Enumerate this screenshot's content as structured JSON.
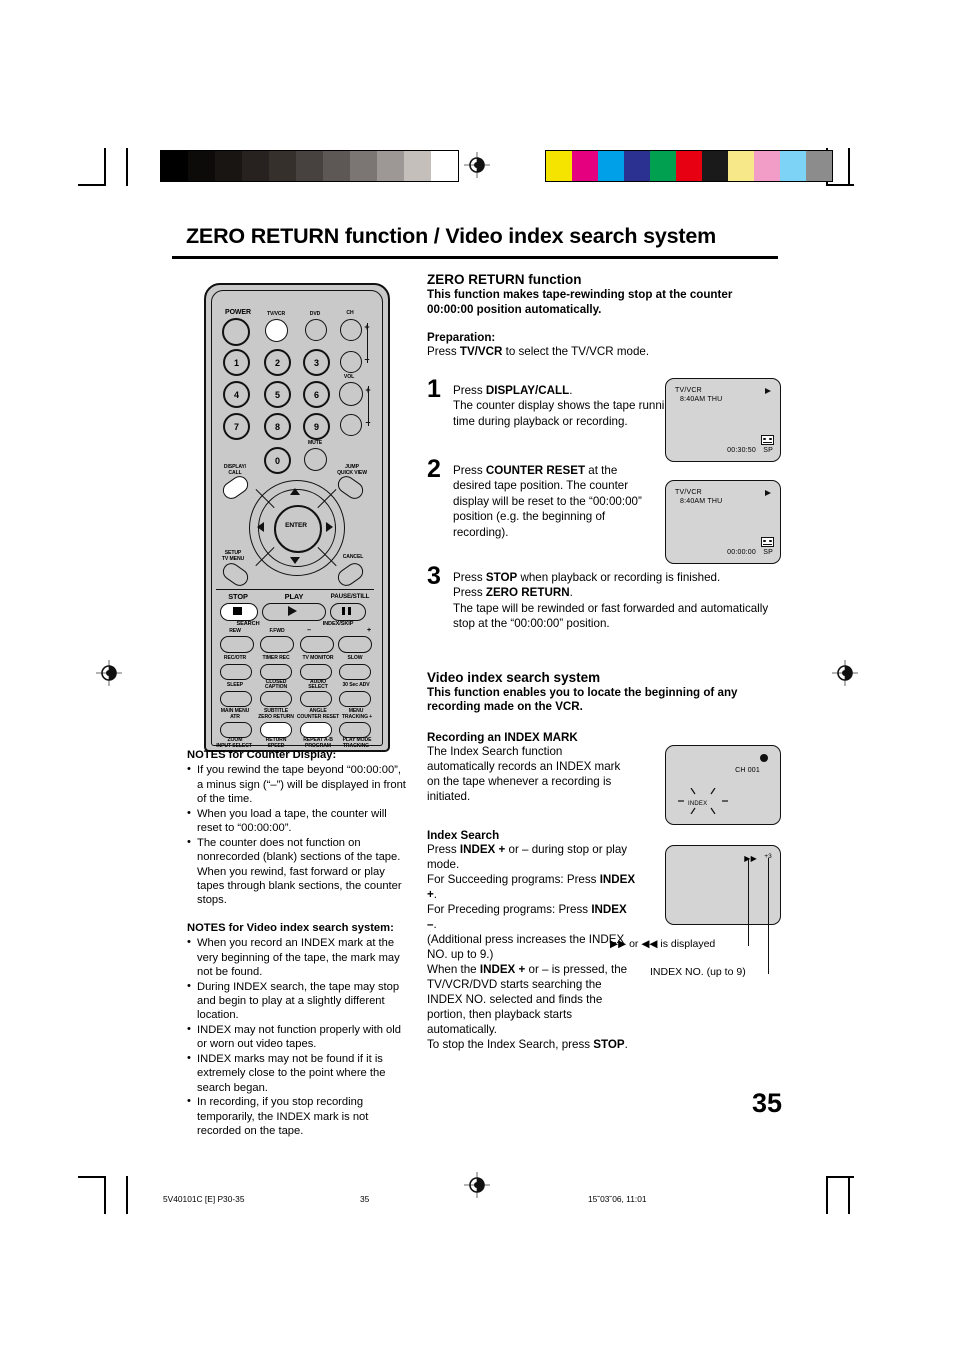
{
  "header": {
    "title": "ZERO RETURN function / Video index search system"
  },
  "zero_return": {
    "heading": "ZERO RETURN function",
    "lead_line1": "This function makes tape-rewinding stop at the counter",
    "lead_line2": "00:00:00 position automatically.",
    "prep_title": "Preparation:",
    "prep_pre": "Press ",
    "prep_bold": "TV/VCR",
    "prep_post": " to select the TV/VCR mode.",
    "steps": [
      {
        "num": "1",
        "l1_pre": "Press ",
        "l1_bold": "DISPLAY/CALL",
        "l1_post": ".",
        "rest": "The counter display shows the tape running time during playback or recording."
      },
      {
        "num": "2",
        "l1_pre": "Press ",
        "l1_bold": "COUNTER RESET",
        "l1_post": " at the",
        "rest": "desired tape position. The counter display will be reset to the “00:00:00” position (e.g. the beginning of recording)."
      },
      {
        "num": "3",
        "l1_pre": "Press ",
        "l1_bold": "STOP",
        "l1_post": " when playback or recording is finished.",
        "l2_pre": "Press ",
        "l2_bold": "ZERO RETURN",
        "l2_post": ".",
        "rest": "The tape will be rewinded or fast forwarded and automatically stop at the “00:00:00” position."
      }
    ]
  },
  "tv_screens": {
    "screen1": {
      "mode": "TV/VCR",
      "clock": "8:40AM  THU",
      "counter": "00:30:50",
      "speed": "SP",
      "play_icon": "play-triangle-icon"
    },
    "screen2": {
      "mode": "TV/VCR",
      "clock": "8:40AM  THU",
      "counter": "00:00:00",
      "speed": "SP",
      "play_icon": "play-triangle-icon"
    },
    "screen3": {
      "channel": "CH  001",
      "index_label": "INDEX",
      "rec_icon": "record-dot-icon"
    },
    "screen4": {
      "ff_icon": "▶▶",
      "index_no": "+3"
    }
  },
  "video_index": {
    "heading": "Video index search system",
    "lead_line1": "This function enables you to locate the beginning of any",
    "lead_line2": "recording made on the VCR.",
    "rec_heading": "Recording an INDEX MARK",
    "rec_body": "The Index Search function automatically records an INDEX mark on the tape whenever a recording is initiated.",
    "search_heading": "Index Search",
    "search_lines": [
      {
        "pre": "Press ",
        "bold": "INDEX +",
        "post": " or – during stop or play mode."
      },
      {
        "pre": "For Succeeding programs: Press ",
        "bold": "INDEX +",
        "post": "."
      },
      {
        "pre": "For Preceding programs: Press ",
        "bold": "INDEX –",
        "post": "."
      },
      {
        "pre": "(Additional press increases the INDEX NO. up to 9.)",
        "bold": "",
        "post": ""
      },
      {
        "pre": "When the ",
        "bold": "INDEX +",
        "post": " or – is pressed, the TV/VCR/DVD starts searching the INDEX NO. selected and finds the portion, then playback starts automatically."
      },
      {
        "pre": "To stop the Index Search, press ",
        "bold": "STOP",
        "post": "."
      }
    ],
    "callout_ff": "▶▶ or ◀◀ is displayed",
    "callout_no": "INDEX NO. (up to 9)"
  },
  "notes": {
    "counter": {
      "heading": "NOTES for Counter Display:",
      "items": [
        "If you rewind the tape beyond “00:00:00”, a minus sign (“–”) will be displayed in front of the time.",
        "When you load a tape, the counter will reset to “00:00:00”.",
        "The counter does not function on nonrecorded (blank) sections of the tape. When you rewind, fast forward or play tapes through blank sections, the counter stops."
      ]
    },
    "index": {
      "heading": "NOTES for Video index search system:",
      "items": [
        "When you record an INDEX mark at the very beginning of the tape, the mark may not be found.",
        "During INDEX search, the tape may stop and begin to play at a slightly different location.",
        "INDEX may not function properly with old or worn out video tapes.",
        "INDEX marks may not be found if it is extremely close to the point where the search began.",
        "In recording, if you stop recording temporarily, the INDEX mark is not recorded on the tape."
      ]
    }
  },
  "remote": {
    "power": "POWER",
    "tvvcr": "TV/VCR",
    "dvd": "DVD",
    "ch": "CH",
    "vol": "VOL",
    "plus": "+",
    "minus": "–",
    "numbers": [
      "1",
      "2",
      "3",
      "4",
      "5",
      "6",
      "7",
      "8",
      "9",
      "0"
    ],
    "mute": "MUTE",
    "display_call_1": "DISPLAY/",
    "display_call_2": "CALL",
    "jump_1": "JUMP",
    "jump_2": "QUICK VIEW",
    "enter": "ENTER",
    "setup_1": "SETUP",
    "setup_2": "TV MENU",
    "cancel": "CANCEL",
    "stop": "STOP",
    "play": "PLAY",
    "pause": "PAUSE/STILL",
    "search": "SEARCH",
    "rew": "REW",
    "ffwd": "F.FWD",
    "index_skip": "INDEX/SKIP",
    "row_a": [
      "REC/OTR",
      "TIMER REC",
      "TV MONITOR",
      "SLOW"
    ],
    "row_b_top": [
      "SLEEP",
      "CLOSED\nCAPTION",
      "AUDIO\nSELECT",
      "30 Sec ADV"
    ],
    "row_c_top": [
      "MAIN MENU",
      "SUBTITLE",
      "ANGLE",
      "MENU"
    ],
    "row_c_bot": [
      "ATR",
      "ZERO RETURN",
      "COUNTER RESET",
      "TRACKING +"
    ],
    "row_d_top": [
      "ZOOM",
      "RETURN",
      "REPEAT A-B",
      "PLAY MODE"
    ],
    "row_d_bot": [
      "INPUT SELECT",
      "SPEED",
      "PROGRAM",
      "TRACKING –"
    ]
  },
  "footer": {
    "doc_code": "5V40101C [E] P30-35",
    "page_small": "35",
    "timestamp": "15˘03˘06, 11:01",
    "page_big": "35"
  },
  "print_marks": {
    "grayscale": [
      "#000000",
      "#0d0b0a",
      "#191512",
      "#272220",
      "#35302c",
      "#474240",
      "#5d5855",
      "#7b7673",
      "#9d9895",
      "#c4bfbb",
      "#ffffff"
    ],
    "colors": [
      "#f5e400",
      "#e4007f",
      "#00a0e9",
      "#2b3190",
      "#00a050",
      "#e60012",
      "#1a1a1a",
      "#f7e98a",
      "#f29dc8",
      "#7dd3f5",
      "#8c8c8c"
    ]
  }
}
